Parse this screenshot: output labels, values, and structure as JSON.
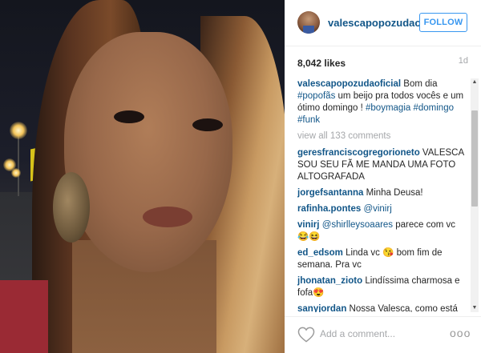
{
  "post": {
    "username": "valescapopozudao...",
    "follow_label": "FOLLOW",
    "likes": "8,042 likes",
    "age": "1d"
  },
  "caption": {
    "user": "valescapopozudaoficial",
    "text_1": " Bom dia ",
    "tag_1": "#popofãs",
    "text_2": " um beijo pra todos vocês e um ótimo domingo ! ",
    "tag_2": "#boymagia",
    "tag_3": "#domingo",
    "tag_4": "#funk"
  },
  "view_all": "view all 133 comments",
  "comments": [
    {
      "user": "geresfranciscogregorioneto",
      "text": " VALESCA SOU SEU FÃ ME MANDA UMA FOTO ALTOGRAFADA"
    },
    {
      "user": "jorgefsantanna",
      "text": " Minha Deusa!"
    },
    {
      "user": "rafinha.pontes",
      "mention": "@vinirj",
      "text": ""
    },
    {
      "user": "vinirj",
      "mention": "@shirlleysoaares",
      "text": " parece com vc 😂😆"
    },
    {
      "user": "ed_edsom",
      "text": " Linda vc 😘 bom fim de semana. Pra vc"
    },
    {
      "user": "jhonatan_zioto",
      "text": " Lindíssima charmosa e fofa😍"
    },
    {
      "user": "sanyjordan",
      "text": " Nossa Valesca, como está magra. Maravilhosa de todas as maneiras"
    }
  ],
  "footer": {
    "add_comment_placeholder": "Add a comment...",
    "more_label": "ooo"
  },
  "icons": {
    "heart": "heart-icon",
    "more": "more-options-icon",
    "avatar": "avatar"
  },
  "colors": {
    "link": "#125688",
    "follow": "#3897f0",
    "muted": "#a5a7aa"
  }
}
